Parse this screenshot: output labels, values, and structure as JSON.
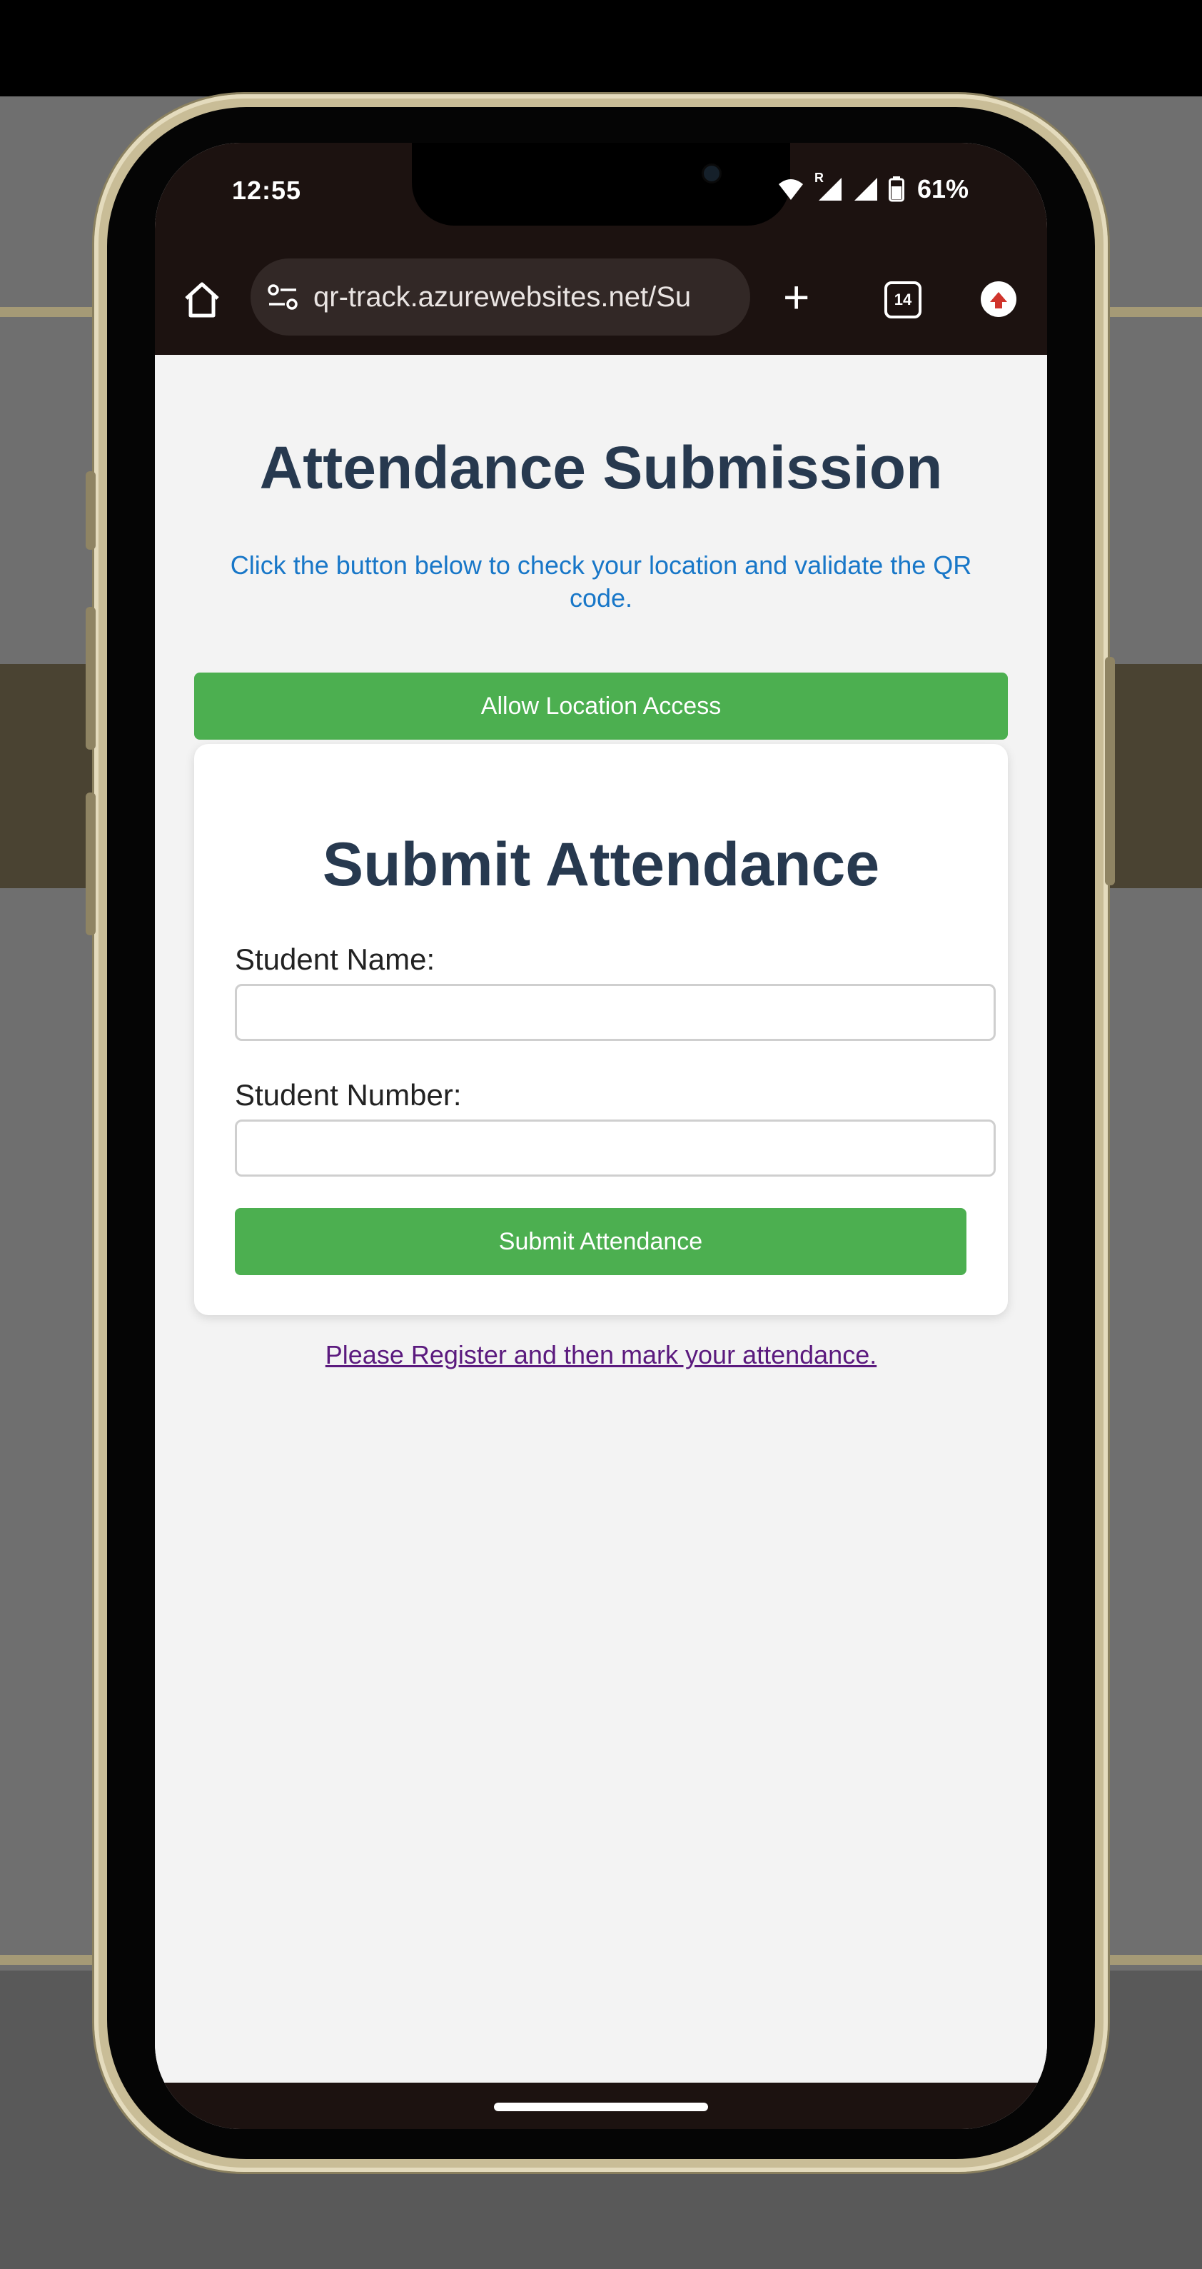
{
  "status_bar": {
    "time": "12:55",
    "roaming_label": "R",
    "battery": "61%"
  },
  "browser": {
    "url": "qr-track.azurewebsites.net/Su",
    "tab_count": "14",
    "icons": [
      "home-icon",
      "site-settings-icon",
      "new-tab-icon",
      "tabs-icon",
      "menu-update-icon"
    ]
  },
  "page": {
    "title": "Attendance Submission",
    "description": "Click the button below to check your location and validate the QR code.",
    "allow_location_button": "Allow Location Access",
    "form": {
      "title": "Submit Attendance",
      "student_name_label": "Student Name:",
      "student_name_value": "",
      "student_number_label": "Student Number:",
      "student_number_value": "",
      "submit_button": "Submit Attendance"
    },
    "register_link": "Please Register and then mark your attendance."
  },
  "colors": {
    "accent_green": "#4caf50",
    "title_navy": "#27394f",
    "desc_blue": "#1877c8",
    "link_purple": "#5b1a7e",
    "browser_chrome": "#1c1210"
  }
}
